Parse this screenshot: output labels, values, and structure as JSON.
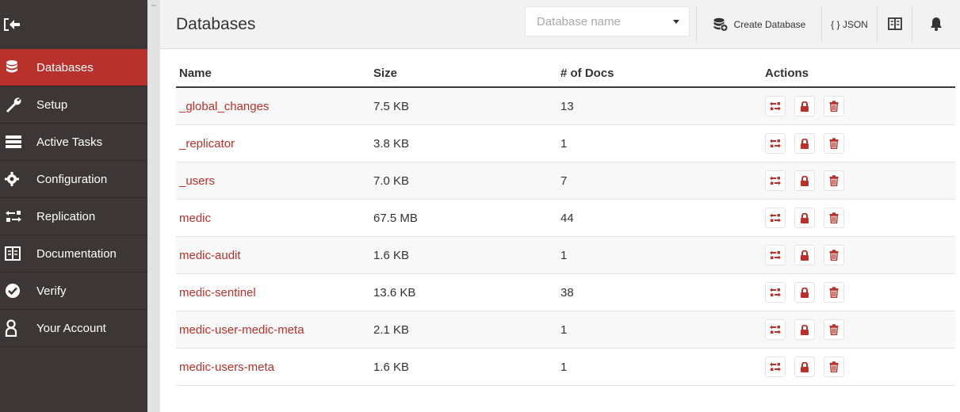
{
  "sidebar": {
    "items": [
      {
        "label": "Databases",
        "icon": "database-icon",
        "active": true
      },
      {
        "label": "Setup",
        "icon": "wrench-icon"
      },
      {
        "label": "Active Tasks",
        "icon": "tasks-icon"
      },
      {
        "label": "Configuration",
        "icon": "gear-icon"
      },
      {
        "label": "Replication",
        "icon": "replication-icon"
      },
      {
        "label": "Documentation",
        "icon": "book-icon"
      },
      {
        "label": "Verify",
        "icon": "check-circle-icon"
      },
      {
        "label": "Your Account",
        "icon": "user-icon"
      }
    ]
  },
  "header": {
    "title": "Databases",
    "search_placeholder": "Database name",
    "create_label": "Create Database",
    "json_label": "{ } JSON"
  },
  "table": {
    "columns": [
      "Name",
      "Size",
      "# of Docs",
      "Actions"
    ],
    "rows": [
      {
        "name": "_global_changes",
        "size": "7.5 KB",
        "docs": "13"
      },
      {
        "name": "_replicator",
        "size": "3.8 KB",
        "docs": "1"
      },
      {
        "name": "_users",
        "size": "7.0 KB",
        "docs": "7"
      },
      {
        "name": "medic",
        "size": "67.5 MB",
        "docs": "44"
      },
      {
        "name": "medic-audit",
        "size": "1.6 KB",
        "docs": "1"
      },
      {
        "name": "medic-sentinel",
        "size": "13.6 KB",
        "docs": "38"
      },
      {
        "name": "medic-user-medic-meta",
        "size": "2.1 KB",
        "docs": "1"
      },
      {
        "name": "medic-users-meta",
        "size": "1.6 KB",
        "docs": "1"
      }
    ]
  },
  "colors": {
    "accent": "#b8312a",
    "sidebar_bg": "#3c3736",
    "header_bg": "#f2f2f2"
  }
}
